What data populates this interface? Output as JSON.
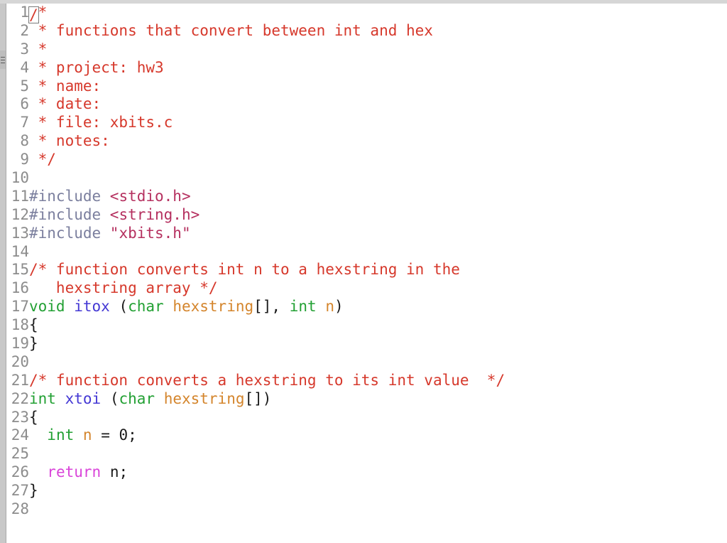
{
  "window": {
    "title": "xbits.c",
    "kind": "text-editor",
    "background": "#ffffff"
  },
  "colors": {
    "comment": "#d6382b",
    "preprocessor": "#7b7f9e",
    "header_path": "#b5305f",
    "string": "#b5305f",
    "type_keyword": "#22a033",
    "function_name": "#4438d4",
    "variable": "#d4852c",
    "control_keyword": "#d944d9",
    "plain_text": "#1a1a1a",
    "line_number": "#8c8c8c",
    "gutter_rail": "#c8c8c8",
    "top_rail": "#d6d6d6"
  },
  "cursor": {
    "line": 1,
    "column": 1,
    "style": "hollow-box",
    "character": "/"
  },
  "gutter": {
    "first_line": 1,
    "last_line": 28,
    "show_line_numbers": true
  },
  "panel_handle": {
    "name": "side-panel-drag-handle",
    "bars": 3
  },
  "lines": [
    {
      "n": "1",
      "tokens": [
        {
          "t": "/",
          "c": "comment",
          "caret": true
        },
        {
          "t": "*",
          "c": "comment"
        }
      ]
    },
    {
      "n": "2",
      "tokens": [
        {
          "t": " * functions that convert between int and hex",
          "c": "comment"
        }
      ]
    },
    {
      "n": "3",
      "tokens": [
        {
          "t": " *",
          "c": "comment"
        }
      ]
    },
    {
      "n": "4",
      "tokens": [
        {
          "t": " * project: hw3",
          "c": "comment"
        }
      ]
    },
    {
      "n": "5",
      "tokens": [
        {
          "t": " * name:",
          "c": "comment"
        }
      ]
    },
    {
      "n": "6",
      "tokens": [
        {
          "t": " * date:",
          "c": "comment"
        }
      ]
    },
    {
      "n": "7",
      "tokens": [
        {
          "t": " * file: xbits.c",
          "c": "comment"
        }
      ]
    },
    {
      "n": "8",
      "tokens": [
        {
          "t": " * notes:",
          "c": "comment"
        }
      ]
    },
    {
      "n": "9",
      "tokens": [
        {
          "t": " */",
          "c": "comment"
        }
      ]
    },
    {
      "n": "10",
      "tokens": []
    },
    {
      "n": "11",
      "tokens": [
        {
          "t": "#include ",
          "c": "preproc"
        },
        {
          "t": "<stdio.h>",
          "c": "header"
        }
      ]
    },
    {
      "n": "12",
      "tokens": [
        {
          "t": "#include ",
          "c": "preproc"
        },
        {
          "t": "<string.h>",
          "c": "header"
        }
      ]
    },
    {
      "n": "13",
      "tokens": [
        {
          "t": "#include ",
          "c": "preproc"
        },
        {
          "t": "\"xbits.h\"",
          "c": "string"
        }
      ]
    },
    {
      "n": "14",
      "tokens": []
    },
    {
      "n": "15",
      "tokens": [
        {
          "t": "/* function converts int n to a hexstring in the",
          "c": "comment"
        }
      ]
    },
    {
      "n": "16",
      "tokens": [
        {
          "t": "   hexstring array */",
          "c": "comment"
        }
      ]
    },
    {
      "n": "17",
      "tokens": [
        {
          "t": "void",
          "c": "type"
        },
        {
          "t": " ",
          "c": "plain"
        },
        {
          "t": "itox",
          "c": "func"
        },
        {
          "t": " (",
          "c": "plain"
        },
        {
          "t": "char",
          "c": "type"
        },
        {
          "t": " ",
          "c": "plain"
        },
        {
          "t": "hexstring",
          "c": "var"
        },
        {
          "t": "[], ",
          "c": "plain"
        },
        {
          "t": "int",
          "c": "type"
        },
        {
          "t": " ",
          "c": "plain"
        },
        {
          "t": "n",
          "c": "var"
        },
        {
          "t": ")",
          "c": "plain"
        }
      ]
    },
    {
      "n": "18",
      "tokens": [
        {
          "t": "{",
          "c": "plain"
        }
      ]
    },
    {
      "n": "19",
      "tokens": [
        {
          "t": "}",
          "c": "plain"
        }
      ]
    },
    {
      "n": "20",
      "tokens": []
    },
    {
      "n": "21",
      "tokens": [
        {
          "t": "/* function converts a hexstring to its int value  */",
          "c": "comment"
        }
      ]
    },
    {
      "n": "22",
      "tokens": [
        {
          "t": "int",
          "c": "type"
        },
        {
          "t": " ",
          "c": "plain"
        },
        {
          "t": "xtoi",
          "c": "func"
        },
        {
          "t": " (",
          "c": "plain"
        },
        {
          "t": "char",
          "c": "type"
        },
        {
          "t": " ",
          "c": "plain"
        },
        {
          "t": "hexstring",
          "c": "var"
        },
        {
          "t": "[])",
          "c": "plain"
        }
      ]
    },
    {
      "n": "23",
      "tokens": [
        {
          "t": "{",
          "c": "plain"
        }
      ]
    },
    {
      "n": "24",
      "tokens": [
        {
          "t": "  ",
          "c": "plain"
        },
        {
          "t": "int",
          "c": "type"
        },
        {
          "t": " ",
          "c": "plain"
        },
        {
          "t": "n",
          "c": "var"
        },
        {
          "t": " = ",
          "c": "plain"
        },
        {
          "t": "0",
          "c": "number"
        },
        {
          "t": ";",
          "c": "plain"
        }
      ]
    },
    {
      "n": "25",
      "tokens": []
    },
    {
      "n": "26",
      "tokens": [
        {
          "t": "  ",
          "c": "plain"
        },
        {
          "t": "return",
          "c": "keyword"
        },
        {
          "t": " ",
          "c": "plain"
        },
        {
          "t": "n",
          "c": "plain"
        },
        {
          "t": ";",
          "c": "plain"
        }
      ]
    },
    {
      "n": "27",
      "tokens": [
        {
          "t": "}",
          "c": "plain"
        }
      ]
    },
    {
      "n": "28",
      "tokens": []
    }
  ]
}
